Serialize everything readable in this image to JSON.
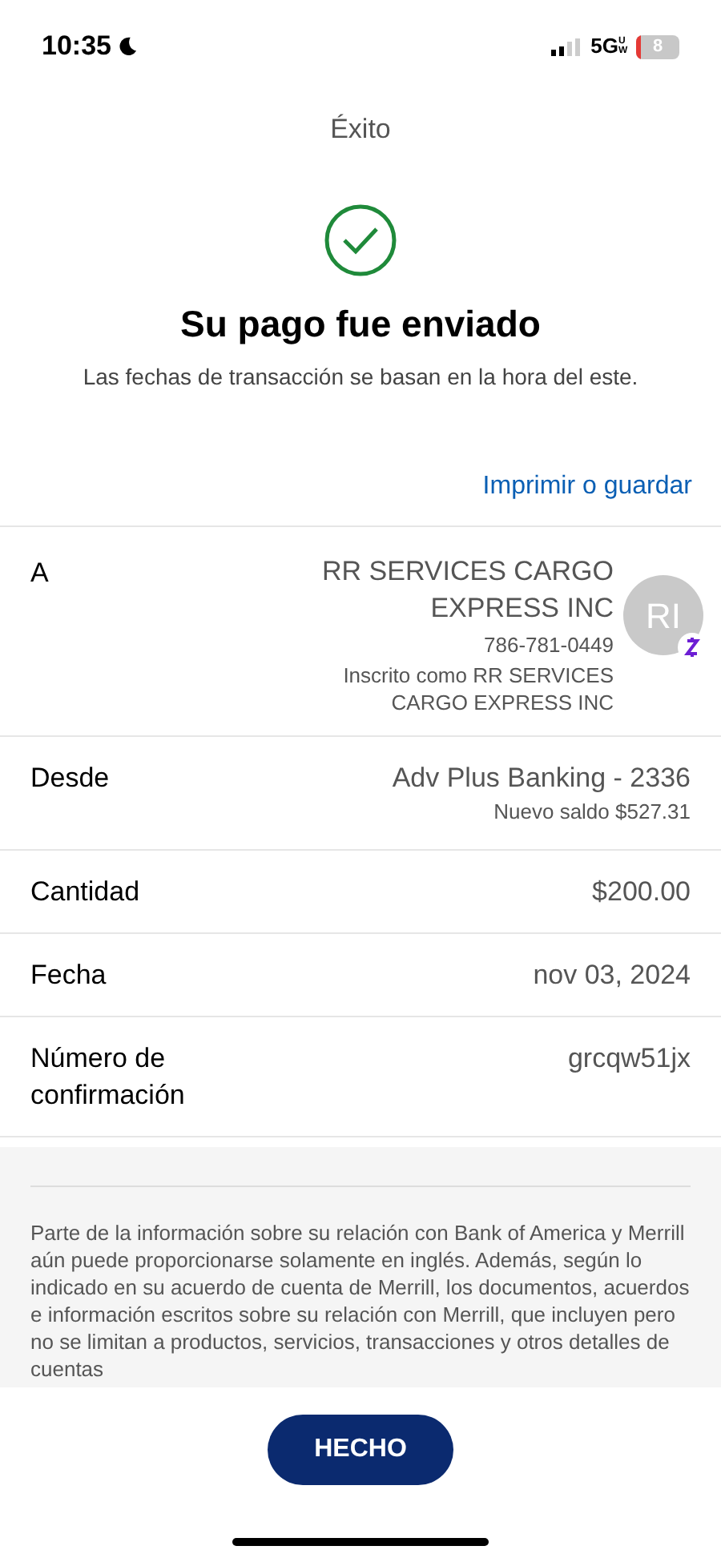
{
  "status_bar": {
    "time": "10:35",
    "network": "5G",
    "network_sub": "UW",
    "battery": "8"
  },
  "header": {
    "title": "Éxito"
  },
  "result": {
    "heading": "Su pago fue enviado",
    "subtitle": "Las fechas de transacción se basan en la hora del este."
  },
  "print_link": "Imprimir o guardar",
  "recipient": {
    "label": "A",
    "name": "RR SERVICES CARGO EXPRESS INC",
    "phone": "786-781-0449",
    "enrolled": "Inscrito como RR SERVICES CARGO EXPRESS INC",
    "initials": "RI"
  },
  "details": [
    {
      "label": "Desde",
      "value": "Adv Plus Banking - 2336",
      "note": "Nuevo saldo $527.31"
    },
    {
      "label": "Cantidad",
      "value": "$200.00"
    },
    {
      "label": "Fecha",
      "value": "nov 03, 2024"
    },
    {
      "label": "Número de confirmación",
      "value": "grcqw51jx"
    }
  ],
  "disclaimer": "Parte de la información sobre su relación con Bank of America y Merrill aún puede proporcionarse solamente en inglés. Además, según lo indicado en su acuerdo de cuenta de Merrill, los documentos, acuerdos e información escritos sobre su relación con Merrill, que incluyen pero no se limitan a productos, servicios, transacciones y otros detalles de cuentas",
  "done_button": "HECHO"
}
